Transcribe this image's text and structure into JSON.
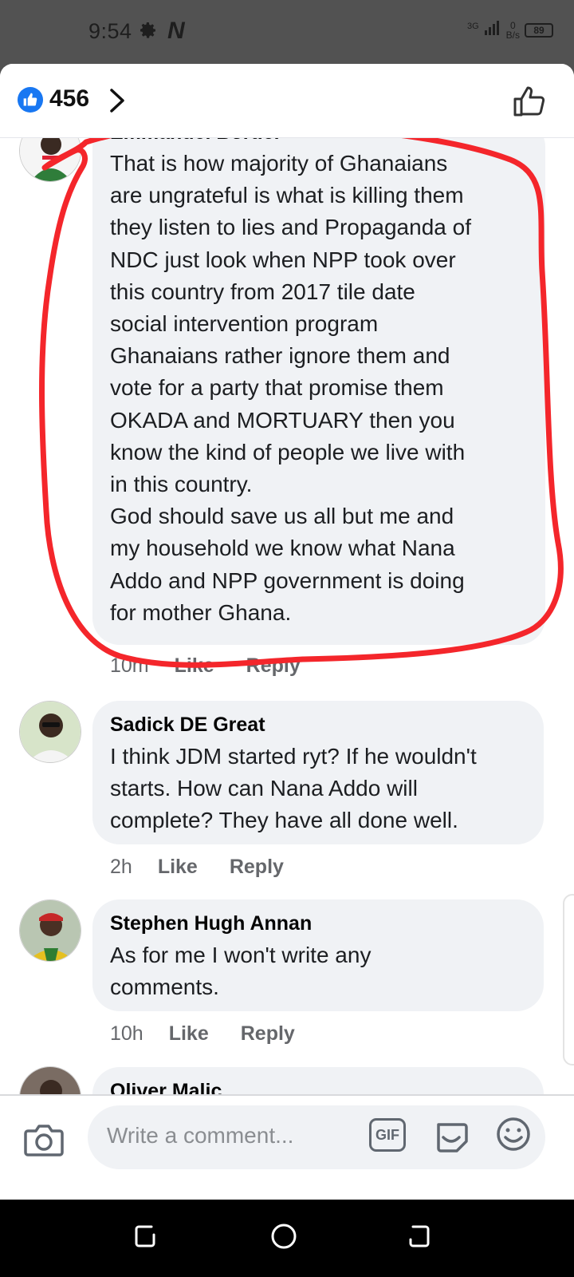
{
  "status_bar": {
    "time": "9:54",
    "network": "3G",
    "speed_value": "0",
    "speed_unit": "B/s",
    "battery": "89"
  },
  "header": {
    "like_count": "456"
  },
  "comments": [
    {
      "author": "Emmanuel Bortier",
      "text": "That is how majority of Ghanaians\nare ungrateful is what is killing them\nthey listen to lies and Propaganda of\nNDC just look when NPP took over\nthis country from 2017 tile date\nsocial intervention program\nGhanaians  rather ignore them and\nvote for a party that promise them\nOKADA and MORTUARY then you\nknow the kind of people we live with\nin this country.\nGod should save us all but me and\nmy household we know what Nana\nAddo and NPP government is doing\nfor mother Ghana.",
      "time": "10m",
      "like": "Like",
      "reply": "Reply"
    },
    {
      "author": "Sadick DE Great",
      "text": "I think JDM started ryt? If he wouldn't\nstarts. How can Nana Addo will\ncomplete? They have all done well.",
      "time": "2h",
      "like": "Like",
      "reply": "Reply"
    },
    {
      "author": "Stephen Hugh Annan",
      "text": "As for me I won't write any\ncomments.",
      "time": "10h",
      "like": "Like",
      "reply": "Reply"
    },
    {
      "author": "Oliver Malic"
    }
  ],
  "composer": {
    "placeholder": "Write a comment...",
    "gif_label": "GIF"
  },
  "annotation_color": "#f4262b",
  "accent_color": "#1877f2"
}
